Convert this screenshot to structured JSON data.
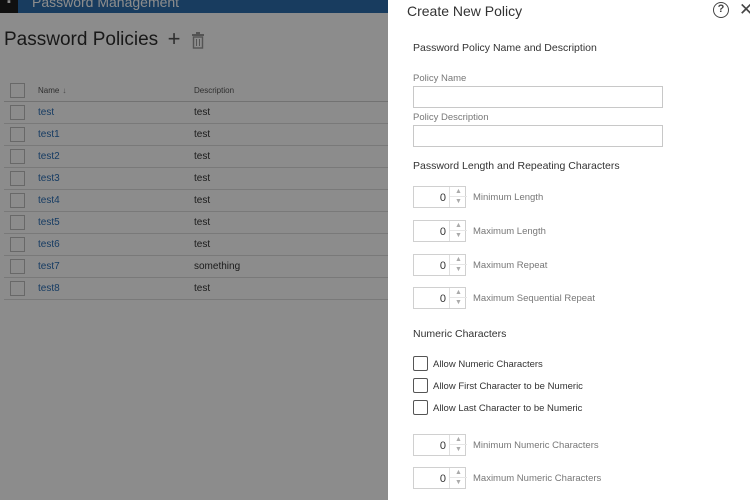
{
  "background": {
    "app_title": "Password Management",
    "page_title": "Password Policies",
    "table": {
      "columns": {
        "name": "Name",
        "description": "Description"
      },
      "rows": [
        {
          "name": "test",
          "description": "test"
        },
        {
          "name": "test1",
          "description": "test"
        },
        {
          "name": "test2",
          "description": "test"
        },
        {
          "name": "test3",
          "description": "test"
        },
        {
          "name": "test4",
          "description": "test"
        },
        {
          "name": "test5",
          "description": "test"
        },
        {
          "name": "test6",
          "description": "test"
        },
        {
          "name": "test7",
          "description": "something"
        },
        {
          "name": "test8",
          "description": "test"
        }
      ]
    }
  },
  "panel": {
    "title": "Create New Policy",
    "sections": {
      "name_desc": "Password Policy Name and Description",
      "length": "Password Length and Repeating Characters",
      "numeric": "Numeric Characters"
    },
    "policy_name": {
      "label": "Policy Name",
      "value": ""
    },
    "policy_description": {
      "label": "Policy Description",
      "value": ""
    },
    "length_fields": [
      {
        "label": "Minimum Length",
        "value": "0"
      },
      {
        "label": "Maximum Length",
        "value": "0"
      },
      {
        "label": "Maximum Repeat",
        "value": "0"
      },
      {
        "label": "Maximum Sequential Repeat",
        "value": "0"
      }
    ],
    "numeric_checks": [
      {
        "label": "Allow Numeric Characters",
        "checked": false
      },
      {
        "label": "Allow First Character to be Numeric",
        "checked": false
      },
      {
        "label": "Allow Last Character to be Numeric",
        "checked": false
      }
    ],
    "numeric_fields": [
      {
        "label": "Minimum Numeric Characters",
        "value": "0"
      },
      {
        "label": "Maximum Numeric Characters",
        "value": "0"
      }
    ]
  },
  "icons": {
    "add": "plus-icon",
    "delete": "trash-icon",
    "help": "help-icon",
    "close": "close-icon",
    "sort": "sort-down-icon"
  }
}
